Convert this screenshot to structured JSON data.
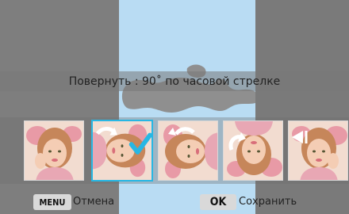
{
  "rotate_label": "Повернуть : 90˚ по часовой стрелке",
  "footer": {
    "menu_key": "MENU",
    "menu_label": "Отмена",
    "ok_key": "OK",
    "ok_label": "Сохранить"
  },
  "thumbnails": [
    {
      "name": "original"
    },
    {
      "name": "rotate-90-cw",
      "selected": true
    },
    {
      "name": "rotate-90-ccw"
    },
    {
      "name": "rotate-180"
    },
    {
      "name": "flip-horizontal"
    }
  ],
  "colors": {
    "preview_bg": "#b9dcf3",
    "selection": "#27b7e4",
    "key_bg": "#d9d9d9"
  }
}
